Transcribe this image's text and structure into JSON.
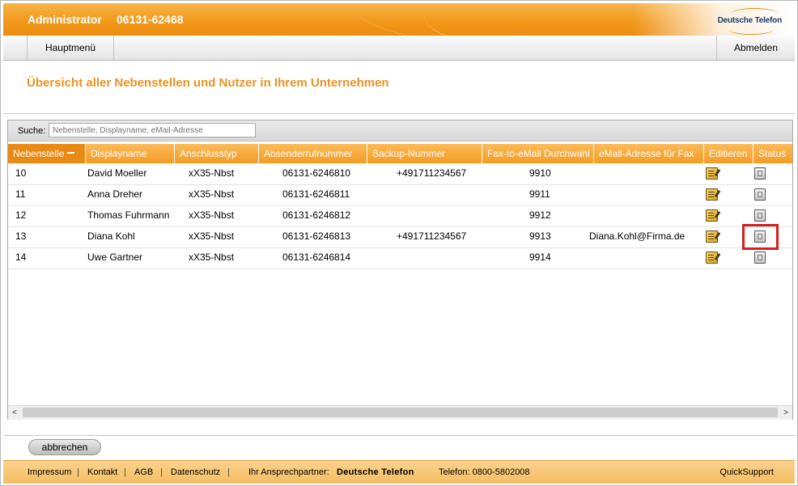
{
  "header": {
    "title": "Administrator",
    "number": "06131-62468",
    "logo": "Deutsche Telefon"
  },
  "nav": {
    "main_menu": "Hauptmenü",
    "logout": "Abmelden"
  },
  "page_title": "Übersicht aller Nebenstellen und Nutzer in Ihrem Unternehmen",
  "search": {
    "label": "Suche:",
    "placeholder": "Nebenstelle, Displayname, eMail-Adresse"
  },
  "table": {
    "columns": [
      "Nebenstelle",
      "Displayname",
      "Anschlusstyp",
      "Absenderrufnummer",
      "Backup-Nummer",
      "Fax-to-eMail Durchwahl",
      "eMail-Adresse für Fax",
      "Editieren",
      "Status"
    ],
    "sorted_column": "Nebenstelle",
    "rows": [
      {
        "nebenstelle": "10",
        "displayname": "David Moeller",
        "anschlusstyp": "xX35-Nbst",
        "absender": "06131-6246810",
        "backup": "+491711234567",
        "fax": "9910",
        "email": ""
      },
      {
        "nebenstelle": "11",
        "displayname": "Anna Dreher",
        "anschlusstyp": "xX35-Nbst",
        "absender": "06131-6246811",
        "backup": "",
        "fax": "9911",
        "email": ""
      },
      {
        "nebenstelle": "12",
        "displayname": "Thomas Fuhrmann",
        "anschlusstyp": "xX35-Nbst",
        "absender": "06131-6246812",
        "backup": "",
        "fax": "9912",
        "email": ""
      },
      {
        "nebenstelle": "13",
        "displayname": "Diana Kohl",
        "anschlusstyp": "xX35-Nbst",
        "absender": "06131-6246813",
        "backup": "+491711234567",
        "fax": "9913",
        "email": "Diana.Kohl@Firma.de"
      },
      {
        "nebenstelle": "14",
        "displayname": "Uwe Gartner",
        "anschlusstyp": "xX35-Nbst",
        "absender": "06131-6246814",
        "backup": "",
        "fax": "9914",
        "email": ""
      }
    ],
    "edit_icon": "edit-icon",
    "status_icon": "status-icon",
    "highlighted_row": "13"
  },
  "buttons": {
    "cancel": "abbrechen"
  },
  "footer": {
    "impressum": "Impressum",
    "kontakt": "Kontakt",
    "agb": "AGB",
    "datenschutz": "Datenschutz",
    "contact_label": "Ihr Ansprechpartner:",
    "contact_name": "Deutsche Telefon",
    "phone": "Telefon: 0800-5802008",
    "quicksupport": "QuickSupport",
    "separator": "|"
  },
  "colors": {
    "accent": "#f29a1c",
    "title": "#ec9320",
    "highlight": "#d4201e"
  }
}
